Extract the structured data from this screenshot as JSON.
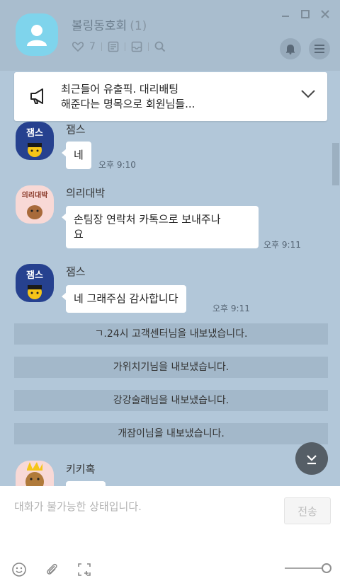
{
  "header": {
    "room_name": "볼링동호회",
    "member_count": "(1)",
    "likes": "7"
  },
  "notice": {
    "text_line1": "최근들어 유출픽. 대리배팅",
    "text_line2": "해준다는 명목으로 회원님들..."
  },
  "messages": [
    {
      "sender": "잼스",
      "avatar_label": "잼스",
      "text": "네",
      "time": "오후 9:10"
    },
    {
      "sender": "의리대박",
      "avatar_label": "의리대박",
      "text_line1": "손팀장 연락처 카톡으로 보내주나",
      "text_line2": "요",
      "time": "오후 9:11"
    },
    {
      "sender": "잼스",
      "avatar_label": "잼스",
      "text": "네 그래주심 감사합니다",
      "time": "오후 9:11"
    },
    {
      "sender": "키키혹"
    }
  ],
  "system_messages": [
    "ㄱ.24시 고객센터님을 내보냈습니다.",
    "가위치기님을 내보냈습니다.",
    "강강술래님을 내보냈습니다.",
    "개잠이님을 내보냈습니다."
  ],
  "input": {
    "placeholder": "대화가 불가능한 상태입니다.",
    "send_label": "전송"
  },
  "colors": {
    "chat_bg": "#b2c7d9",
    "header_bg": "#a9bdce",
    "system_bg": "#a3b8ca",
    "bubble": "#ffffff"
  }
}
